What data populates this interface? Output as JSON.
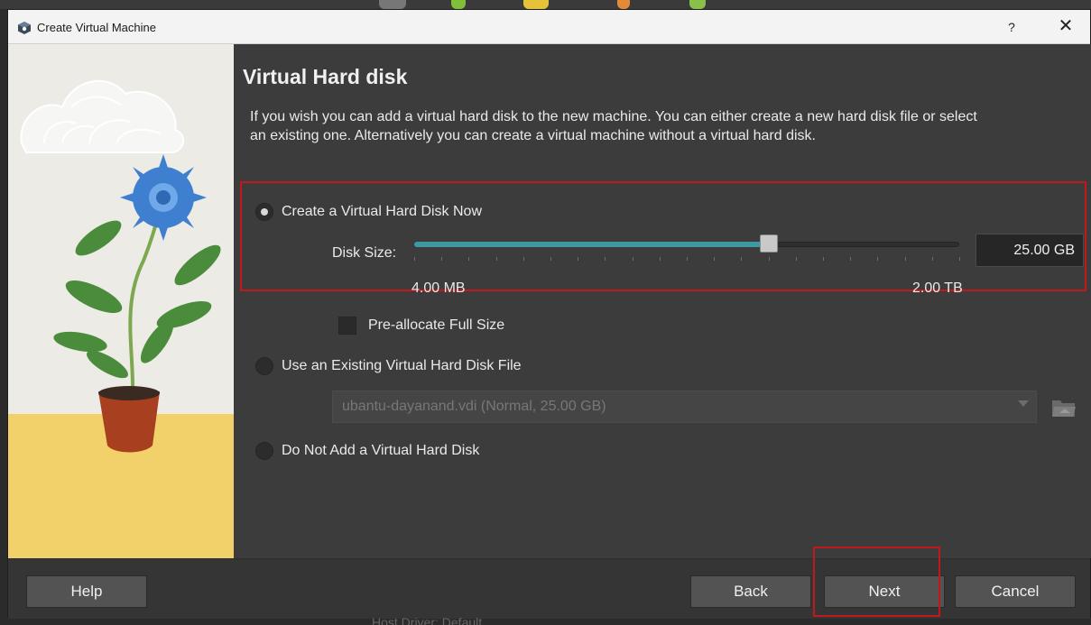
{
  "window": {
    "title": "Create Virtual Machine",
    "help_glyph": "?",
    "close_glyph": "✕"
  },
  "page": {
    "heading": "Virtual Hard disk",
    "description": "If you wish you can add a virtual hard disk to the new machine. You can either create a new hard disk file or select an existing one. Alternatively you can create a virtual machine without a virtual hard disk."
  },
  "options": {
    "create_now": {
      "label": "Create a Virtual Hard Disk Now",
      "selected": true
    },
    "disk_size": {
      "label": "Disk Size:",
      "value": "25.00 GB",
      "min_label": "4.00 MB",
      "max_label": "2.00 TB",
      "slider_position": 0.65
    },
    "preallocate": {
      "label": "Pre-allocate Full Size",
      "checked": false
    },
    "use_existing": {
      "label": "Use an Existing Virtual Hard Disk File",
      "selected": false,
      "file_value": "ubantu-dayanand.vdi (Normal, 25.00 GB)"
    },
    "no_disk": {
      "label": "Do Not Add a Virtual Hard Disk",
      "selected": false
    }
  },
  "buttons": {
    "help": "Help",
    "back": "Back",
    "next": "Next",
    "cancel": "Cancel"
  },
  "background_text": "Host Driver: Default",
  "colors": {
    "accent_slider": "#3d9aa2",
    "highlight_border": "#c0181b",
    "window_bg": "#3c3c3c"
  }
}
